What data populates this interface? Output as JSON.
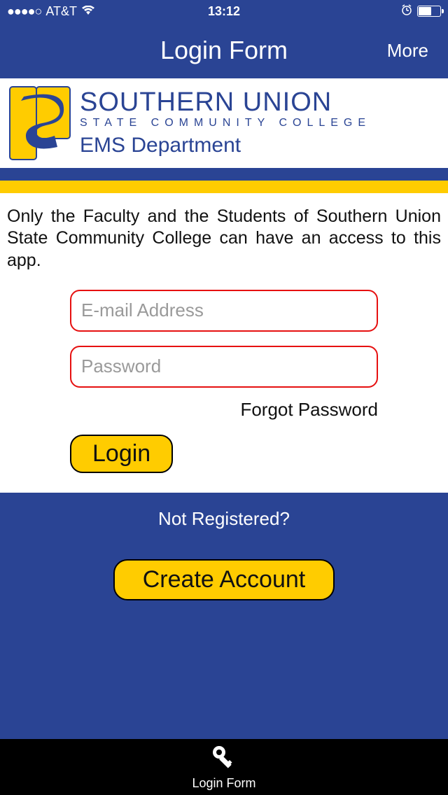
{
  "statusbar": {
    "carrier": "AT&T",
    "time": "13:12"
  },
  "nav": {
    "title": "Login Form",
    "more": "More"
  },
  "logo": {
    "main": "SOUTHERN UNION",
    "sub": "STATE COMMUNITY COLLEGE",
    "dept": "EMS Department"
  },
  "content": {
    "description": "Only the Faculty and the Students of Southern Union State Community College can have an access to this app."
  },
  "form": {
    "email_placeholder": "E-mail Address",
    "password_placeholder": "Password",
    "forgot": "Forgot Password",
    "login": "Login"
  },
  "register": {
    "prompt": "Not Registered?",
    "create": "Create Account"
  },
  "tabbar": {
    "label": "Login Form"
  }
}
